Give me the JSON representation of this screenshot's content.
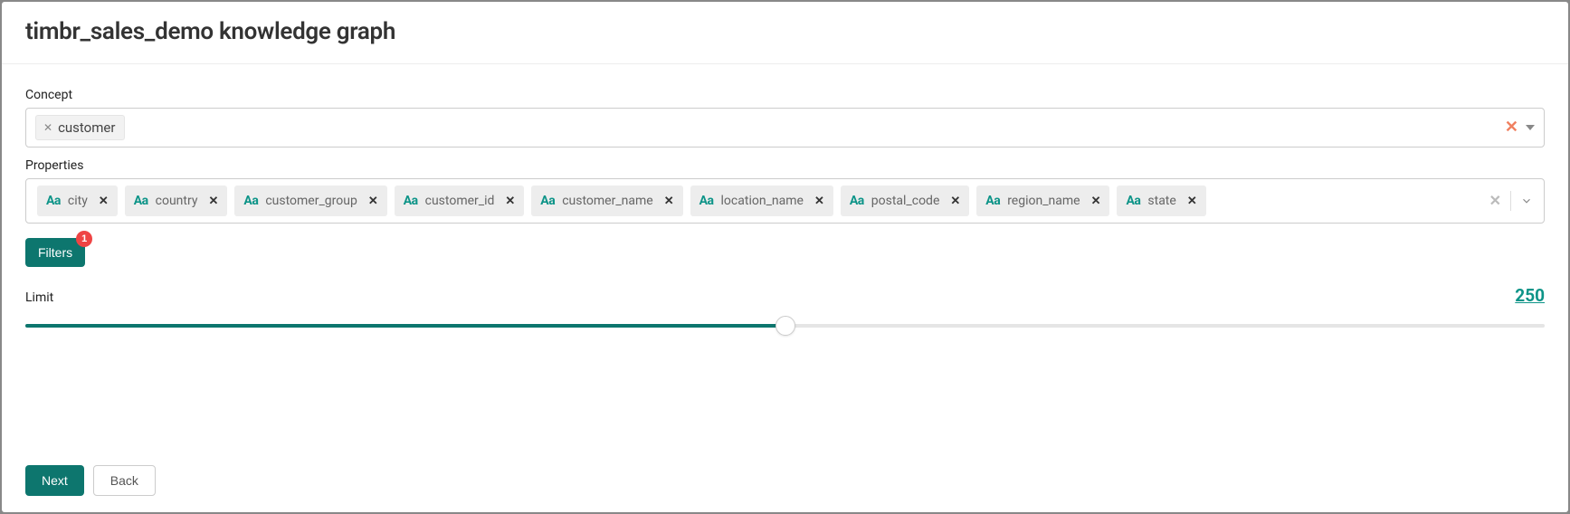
{
  "header": {
    "title": "timbr_sales_demo knowledge graph"
  },
  "concept": {
    "label": "Concept",
    "selected": "customer"
  },
  "properties": {
    "label": "Properties",
    "items": [
      "city",
      "country",
      "customer_group",
      "customer_id",
      "customer_name",
      "location_name",
      "postal_code",
      "region_name",
      "state"
    ]
  },
  "filters": {
    "label": "Filters",
    "badge": "1"
  },
  "limit": {
    "label": "Limit",
    "value": "250",
    "percent": 50
  },
  "footer": {
    "next": "Next",
    "back": "Back"
  }
}
